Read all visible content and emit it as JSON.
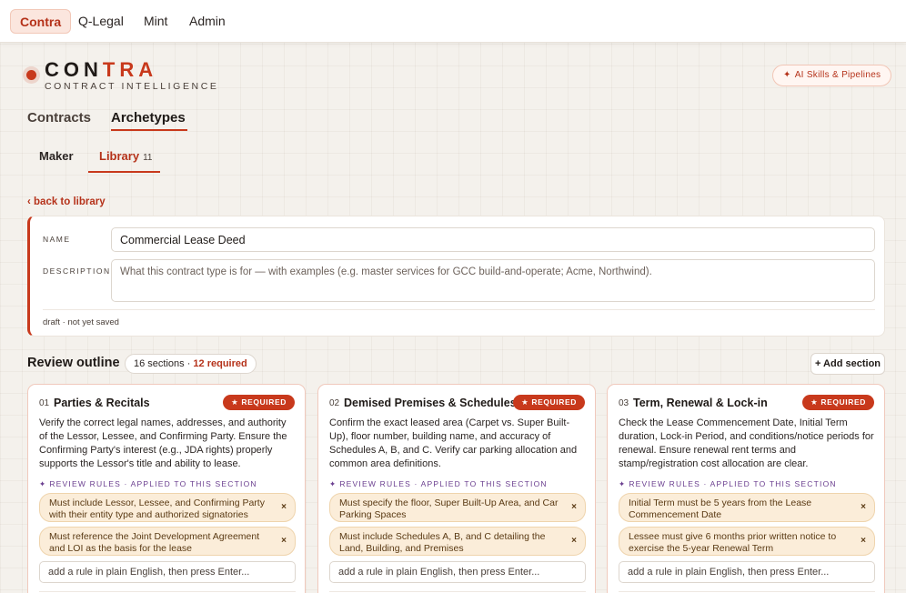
{
  "nav": {
    "items": [
      "Contra",
      "Q-Legal",
      "Mint",
      "Admin"
    ],
    "active": "Contra"
  },
  "brand": {
    "title_part1": "CON",
    "title_part2": "TRA",
    "subtitle": "CONTRACT INTELLIGENCE",
    "ai_button": "AI Skills & Pipelines"
  },
  "primary_tabs": [
    "Contracts",
    "Archetypes"
  ],
  "secondary_tabs": {
    "maker": "Maker",
    "library": "Library",
    "library_count": "11"
  },
  "back_link": "‹ back to library",
  "form": {
    "name_label": "NAME",
    "name_value": "Commercial Lease Deed",
    "description_label": "DESCRIPTION",
    "description_placeholder": "What this contract type is for — with examples (e.g. master services for GCC build-and-operate; Acme, Northwind).",
    "status": "draft · not yet saved"
  },
  "outline": {
    "title": "Review outline",
    "sections_text": "16 sections · ",
    "required_text": "12 required",
    "add_button": "+ Add section"
  },
  "colors": {
    "accent": "#c8391c",
    "rules_purple": "#6a3e8f",
    "chip_bg": "#fbedd9"
  },
  "sections": [
    {
      "num": "01",
      "title": "Parties & Recitals",
      "badge": "REQUIRED",
      "description": "Verify the correct legal names, addresses, and authority of the Lessor, Lessee, and Confirming Party. Ensure the Confirming Party's interest (e.g., JDA rights) properly supports the Lessor's title and ability to lease.",
      "rules_label": "REVIEW RULES · APPLIED TO THIS SECTION",
      "rules": [
        "Must include Lessor, Lessee, and Confirming Party with their entity type and authorized signatories",
        "Must reference the Joint Development Agreement and LOI as the basis for the lease"
      ],
      "rule_placeholder": "add a rule in plain English, then press Enter..."
    },
    {
      "num": "02",
      "title": "Demised Premises & Schedules",
      "badge": "REQUIRED",
      "description": "Confirm the exact leased area (Carpet vs. Super Built-Up), floor number, building name, and accuracy of Schedules A, B, and C. Verify car parking allocation and common area definitions.",
      "rules_label": "REVIEW RULES · APPLIED TO THIS SECTION",
      "rules": [
        "Must specify the floor, Super Built-Up Area, and Car Parking Spaces",
        "Must include Schedules A, B, and C detailing the Land, Building, and Premises"
      ],
      "rule_placeholder": "add a rule in plain English, then press Enter..."
    },
    {
      "num": "03",
      "title": "Term, Renewal & Lock-in",
      "badge": "REQUIRED",
      "description": "Check the Lease Commencement Date, Initial Term duration, Lock-in Period, and conditions/notice periods for renewal. Ensure renewal rent terms and stamp/registration cost allocation are clear.",
      "rules_label": "REVIEW RULES · APPLIED TO THIS SECTION",
      "rules": [
        "Initial Term must be 5 years from the Lease Commencement Date",
        "Lessee must give 6 months prior written notice to exercise the 5-year Renewal Term"
      ],
      "rule_placeholder": "add a rule in plain English, then press Enter..."
    }
  ]
}
